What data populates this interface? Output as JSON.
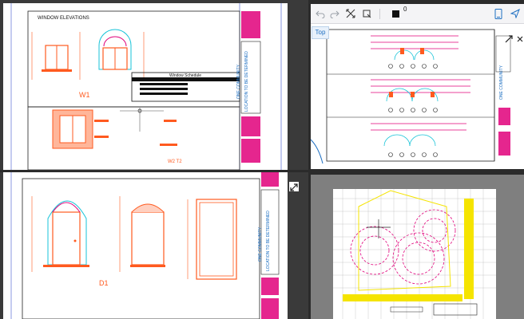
{
  "pane_top_left": {
    "title": "WINDOW ELEVATIONS",
    "window_label": "W1",
    "schedule_title": "Window Schedule",
    "note_label": "W2 T2"
  },
  "pane_bottom_left": {
    "door_label": "D1"
  },
  "pane_top_right": {
    "top_button": "Top",
    "stroke_value": "0"
  },
  "title_block": {
    "project_vertical": "ONE COMMUNITY",
    "location_vertical": "LOCATION TO BE DETERMINED"
  },
  "colors": {
    "background": "#2b2b2b",
    "sheet": "#ffffff",
    "magenta": "#e0007a",
    "orange": "#ff5a1f",
    "cyan": "#17c3d8",
    "yellow": "#f5e400",
    "blue": "#1d6fc2"
  },
  "icons": [
    "undo-icon",
    "redo-icon",
    "fit-icon",
    "crop-icon",
    "color-swatch-icon",
    "device-icon",
    "share-icon",
    "expand-icon",
    "close-icon"
  ]
}
